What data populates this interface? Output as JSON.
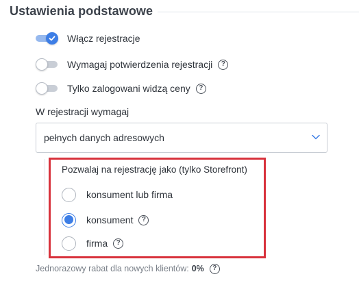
{
  "section": {
    "title": "Ustawienia podstawowe"
  },
  "toggles": [
    {
      "label": "Włącz rejestracje",
      "on": true,
      "help": false
    },
    {
      "label": "Wymagaj potwierdzenia rejestracji",
      "on": false,
      "help": true
    },
    {
      "label": "Tylko zalogowani widzą ceny",
      "on": false,
      "help": true
    }
  ],
  "registration_fields": {
    "label": "W rejestracji wymagaj",
    "value": "pełnych danych adresowych"
  },
  "register_as": {
    "title": "Pozwalaj na rejestrację jako (tylko Storefront)",
    "options": [
      {
        "label": "konsument lub firma",
        "checked": false,
        "help": false
      },
      {
        "label": "konsument",
        "checked": true,
        "help": true
      },
      {
        "label": "firma",
        "checked": false,
        "help": true
      }
    ]
  },
  "discount": {
    "label": "Jednorazowy rabat dla nowych klientów:",
    "value": "0%"
  },
  "help_glyph": "?",
  "colors": {
    "accent": "#3d7ee6",
    "highlight_border": "#d8323c"
  }
}
